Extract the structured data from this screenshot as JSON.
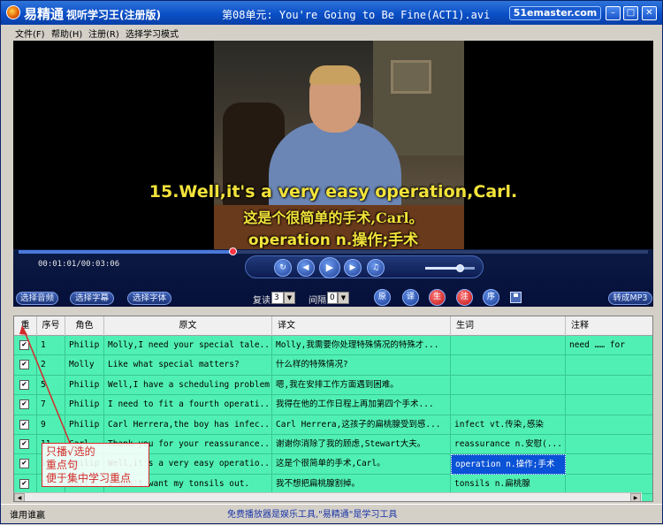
{
  "window": {
    "app_brand": "易精通",
    "app_subtitle": "视听学习王(注册版)",
    "document_title": "第08单元: You're Going to Be Fine(ACT1).avi",
    "site_badge": "51emaster.com"
  },
  "menu": [
    "文件(F)",
    "帮助(H)",
    "注册(R)",
    "选择学习模式"
  ],
  "subtitles": {
    "english": "15.Well,it's a very easy operation,Carl.",
    "chinese": "这是个很简单的手术,Carl。",
    "vocab": "operation n.操作;手术"
  },
  "player": {
    "time": "00:01:01/00:03:06",
    "progress": 0.34,
    "volume": 0.7
  },
  "toolbar": {
    "select_audio": "选择音频",
    "select_subtitle": "选择字幕",
    "select_font": "选择字体",
    "repeat_label": "复读",
    "repeat_value": "3",
    "interval_label": "间隔",
    "interval_value": "0",
    "mode_original": "原",
    "mode_translation": "译",
    "mode_new": "生",
    "mode_note": "注",
    "mode_order": "序",
    "to_mp3": "转成MP3"
  },
  "grid": {
    "columns": [
      "重",
      "序号",
      "角色",
      "原文",
      "译文",
      "生词",
      "注释"
    ],
    "rows": [
      {
        "checked": true,
        "index": "1",
        "role": "Philip",
        "original": "Molly,I need your special tale...",
        "translation": "Molly,我需要你处理特殊情况的特殊才...",
        "vocab": "",
        "note": "need …… for"
      },
      {
        "checked": true,
        "index": "2",
        "role": "Molly",
        "original": "Like what special matters?",
        "translation": "什么样的特殊情况?",
        "vocab": "",
        "note": ""
      },
      {
        "checked": true,
        "index": "5",
        "role": "Philip",
        "original": "Well,I have a scheduling problem.",
        "translation": "嗯,我在安排工作方面遇到困难。",
        "vocab": "",
        "note": ""
      },
      {
        "checked": true,
        "index": "7",
        "role": "Philip",
        "original": "I need to fit a fourth operati...",
        "translation": "我得在他的工作日程上再加第四个手术...",
        "vocab": "",
        "note": ""
      },
      {
        "checked": true,
        "index": "9",
        "role": "Philip",
        "original": "Carl Herrera,the boy has infec...",
        "translation": "Carl Herrera,这孩子的扁桃腺受到感...",
        "vocab": "infect vt.传染,感染",
        "note": ""
      },
      {
        "checked": true,
        "index": "11",
        "role": "Carl",
        "original": "Thank you for your reassurance...",
        "translation": "谢谢你消除了我的顾虑,Stewart大夫。",
        "vocab": "reassurance n.安慰(...",
        "note": ""
      },
      {
        "checked": true,
        "index": "15",
        "role": "Philip",
        "original": "Well,it's a very easy operatio...",
        "translation": "这是个很简单的手术,Carl。",
        "vocab": "operation n.操作;手术",
        "note": ""
      },
      {
        "checked": true,
        "index": "17",
        "role": "Carl",
        "original": "I don't want my tonsils out.",
        "translation": "我不想把扁桃腺割掉。",
        "vocab": "tonsils n.扁桃腺",
        "note": ""
      }
    ]
  },
  "annotation": {
    "line1": "只播√选的",
    "line2": "重点句",
    "line3": "便于集中学习重点"
  },
  "status": {
    "left": "谁用谁赢",
    "center": "免费播放器是娱乐工具,\"易精通\"是学习工具"
  },
  "colors": {
    "grid_bg": "#50f0b4",
    "subtitle": "#f3e33a",
    "callout": "#d42a2a",
    "titlebar": "#0b4fc7"
  }
}
